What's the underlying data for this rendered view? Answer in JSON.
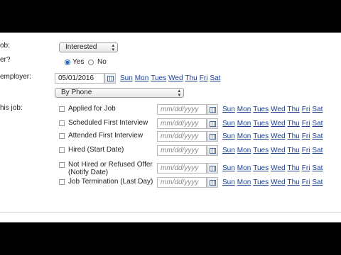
{
  "labels": {
    "status": "ob:",
    "contacted": "er?",
    "contact_date": "employer:",
    "this_job": "his job:"
  },
  "status_select": {
    "value": "Interested"
  },
  "contacted_radios": {
    "yes": "Yes",
    "no": "No",
    "selected": "yes"
  },
  "contact_date": {
    "value": "05/01/2016"
  },
  "method_select": {
    "value": "By Phone"
  },
  "days": [
    "Sun",
    "Mon",
    "Tues",
    "Wed",
    "Thu",
    "Fri",
    "Sat"
  ],
  "date_placeholder": "mm/dd/yyyy",
  "milestones": [
    {
      "label": "Applied for Job",
      "checked": false
    },
    {
      "label": "Scheduled First Interview",
      "checked": false
    },
    {
      "label": "Attended First Interview",
      "checked": false
    },
    {
      "label": "Hired (Start Date)",
      "checked": false
    },
    {
      "label": "Not Hired or Refused Offer",
      "label2": "(Notify Date)",
      "checked": false
    },
    {
      "label": "Job Termination (Last Day)",
      "checked": false
    }
  ]
}
